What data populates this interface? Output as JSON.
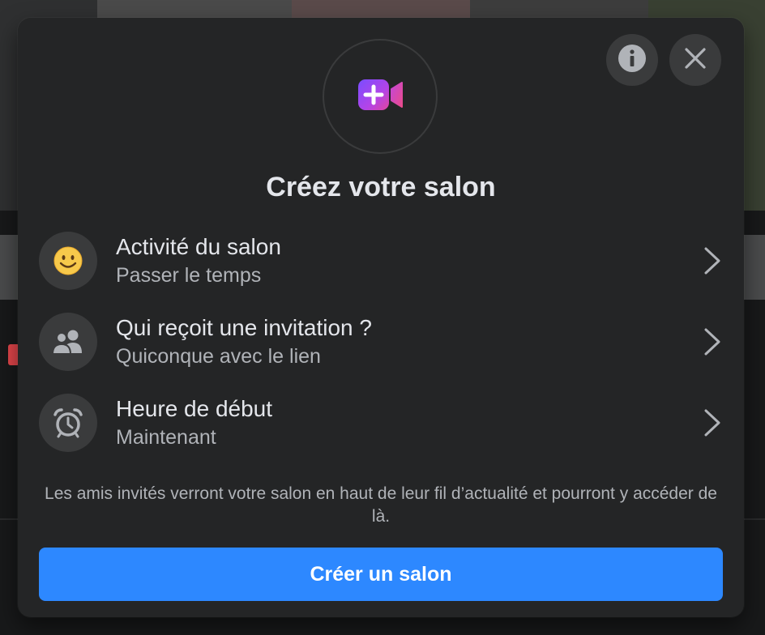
{
  "modal": {
    "title": "Créez votre salon",
    "info_icon": "info-icon",
    "close_icon": "close-icon",
    "hero_icon": "video-plus-icon"
  },
  "options": [
    {
      "icon": "smiley-icon",
      "title": "Activité du salon",
      "value": "Passer le temps"
    },
    {
      "icon": "people-icon",
      "title": "Qui reçoit une invitation ?",
      "value": "Quiconque avec le lien"
    },
    {
      "icon": "alarm-clock-icon",
      "title": "Heure de début",
      "value": "Maintenant"
    }
  ],
  "note": "Les amis invités verront votre salon en haut de leur fil d’actualité et pourront y accéder de là.",
  "create_button_label": "Créer un salon",
  "colors": {
    "modal_bg": "#242526",
    "primary": "#2d88ff",
    "text_primary": "#e4e6eb",
    "text_secondary": "#b0b3b8",
    "icon_bg": "#3a3b3c"
  }
}
